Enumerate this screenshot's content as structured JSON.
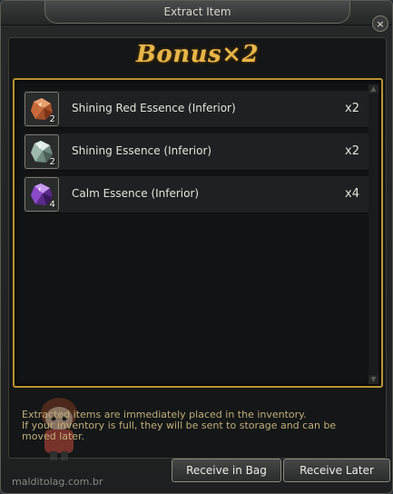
{
  "window": {
    "title": "Extract Item",
    "close_symbol": "×"
  },
  "bonus": {
    "text": "Bonus×2"
  },
  "items": [
    {
      "name": "Shining Red Essence (Inferior)",
      "stack": "2",
      "count": "x2",
      "icon": "red-essence-icon",
      "color": "#c86a3a"
    },
    {
      "name": "Shining Essence (Inferior)",
      "stack": "2",
      "count": "x2",
      "icon": "shining-essence-icon",
      "color": "#9fb8ae"
    },
    {
      "name": "Calm Essence (Inferior)",
      "stack": "4",
      "count": "x4",
      "icon": "calm-essence-icon",
      "color": "#8a4ac8"
    }
  ],
  "notice": {
    "line1": "Extracted items are immediately placed in the inventory.",
    "line2": "If your inventory is full, they will be sent to storage and can be",
    "line3": "moved later."
  },
  "buttons": {
    "receive_in_bag": "Receive in Bag",
    "receive_later": "Receive Later"
  },
  "watermark": "malditolag.com.br",
  "colors": {
    "accent_gold": "#e6b64a",
    "border_gold": "#b8932f"
  }
}
